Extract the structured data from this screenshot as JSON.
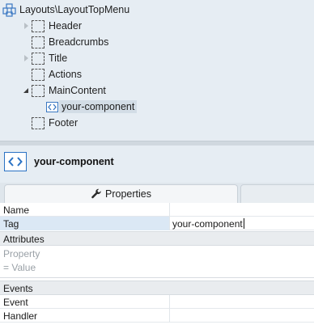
{
  "tree": {
    "root_label": "Layouts\\LayoutTopMenu",
    "nodes": [
      {
        "label": "Header"
      },
      {
        "label": "Breadcrumbs"
      },
      {
        "label": "Title"
      },
      {
        "label": "Actions"
      },
      {
        "label": "MainContent"
      },
      {
        "label": "your-component"
      },
      {
        "label": "Footer"
      }
    ]
  },
  "header": {
    "title": "your-component"
  },
  "tabs": {
    "properties_label": "Properties"
  },
  "grid": {
    "name_key": "Name",
    "name_value": "",
    "tag_key": "Tag",
    "tag_value": "your-component",
    "attributes_section": "Attributes",
    "attr_property_hint": "Property",
    "attr_value_hint": "=  Value",
    "events_section": "Events",
    "event_key": "Event",
    "handler_key": "Handler"
  },
  "colors": {
    "accent": "#2a72c4",
    "tree_bg": "#e6edf3",
    "selection": "#dbe8f5"
  }
}
